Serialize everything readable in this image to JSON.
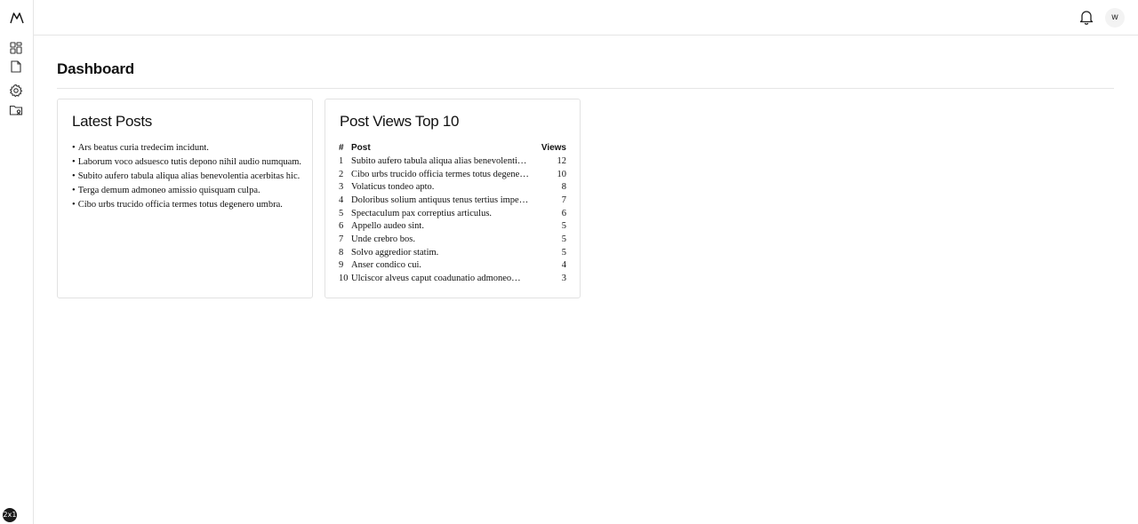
{
  "sidebar": {
    "items": [
      {
        "name": "dashboard",
        "icon": "grid-icon"
      },
      {
        "name": "posts",
        "icon": "document-icon"
      },
      {
        "name": "settings",
        "icon": "gear-icon"
      },
      {
        "name": "media",
        "icon": "folder-image-icon"
      }
    ],
    "logo_icon": "mountain-logo-icon",
    "badge": "2x1"
  },
  "topbar": {
    "notification_icon": "bell-icon",
    "avatar_initial": "w"
  },
  "page": {
    "title": "Dashboard"
  },
  "latest_posts": {
    "title": "Latest Posts",
    "items": [
      "Ars beatus curia tredecim incidunt.",
      "Laborum voco adsuesco tutis depono nihil audio numquam.",
      "Subito aufero tabula aliqua alias benevolentia acerbitas hic.",
      "Terga demum admoneo amissio quisquam culpa.",
      "Cibo urbs trucido officia termes totus degenero umbra."
    ]
  },
  "post_views": {
    "title": "Post Views Top 10",
    "headers": {
      "rank": "#",
      "post": "Post",
      "views": "Views"
    },
    "rows": [
      {
        "rank": "1",
        "post": "Subito aufero tabula aliqua alias benevolentia…",
        "views": "12"
      },
      {
        "rank": "2",
        "post": "Cibo urbs trucido officia termes totus degenero…",
        "views": "10"
      },
      {
        "rank": "3",
        "post": "Volaticus tondeo apto.",
        "views": "8"
      },
      {
        "rank": "4",
        "post": "Doloribus solium antiquus tenus tertius imped…",
        "views": "7"
      },
      {
        "rank": "5",
        "post": "Spectaculum pax correptius articulus.",
        "views": "6"
      },
      {
        "rank": "6",
        "post": "Appello audeo sint.",
        "views": "5"
      },
      {
        "rank": "7",
        "post": "Unde crebro bos.",
        "views": "5"
      },
      {
        "rank": "8",
        "post": "Solvo aggredior statim.",
        "views": "5"
      },
      {
        "rank": "9",
        "post": "Anser condico cui.",
        "views": "4"
      },
      {
        "rank": "10",
        "post": "Ulciscor alveus caput coadunatio admoneo…",
        "views": "3"
      }
    ]
  }
}
